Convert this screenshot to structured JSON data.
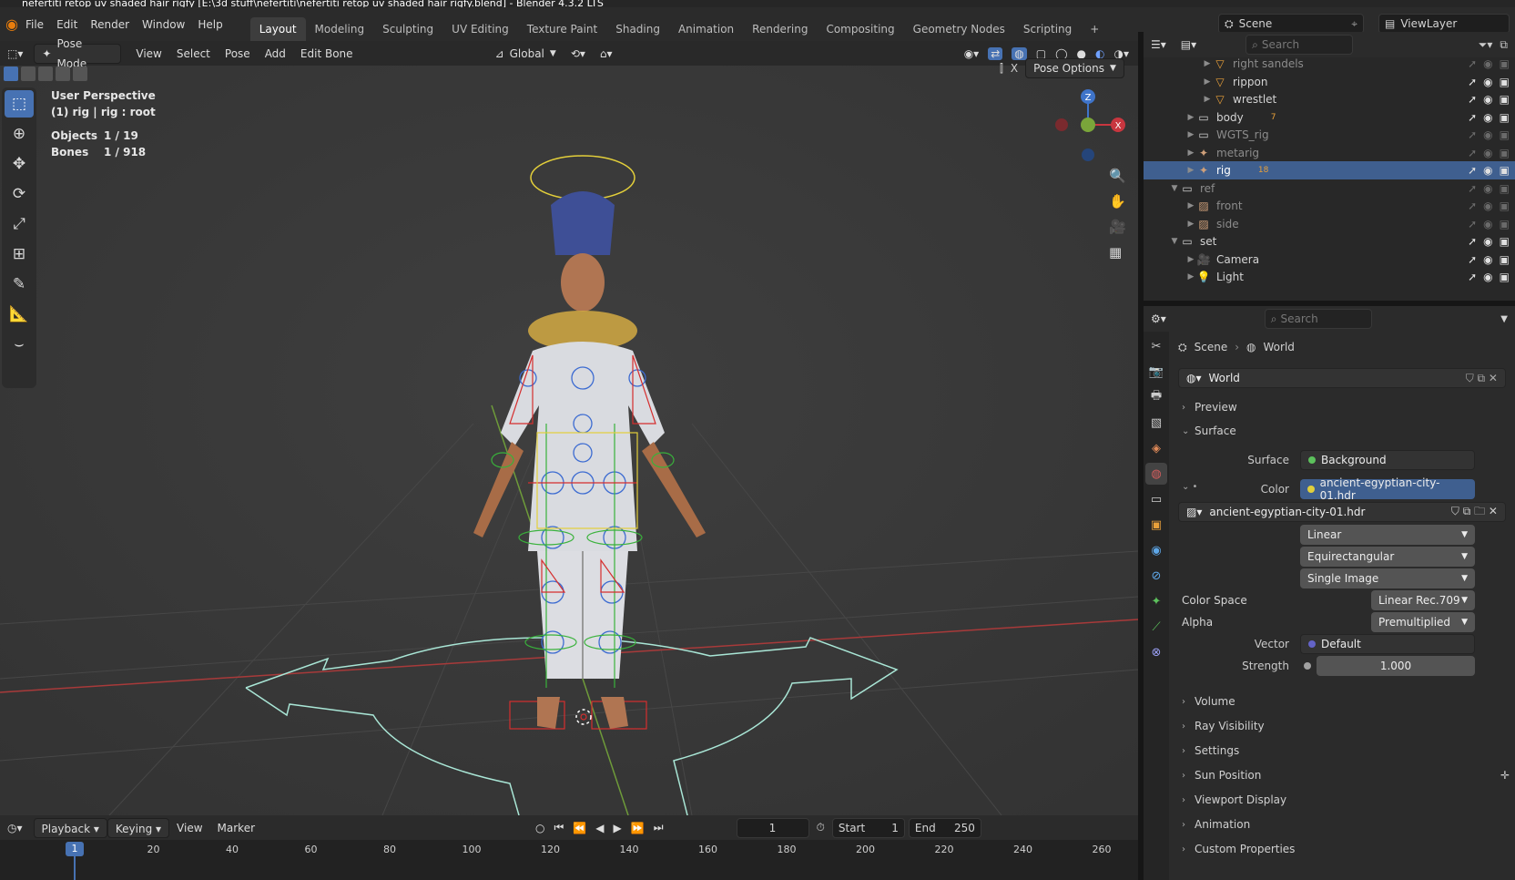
{
  "window_title": "nefertiti retop uv shaded  hair rigfy [E:\\3d stuff\\nefertiti\\nefertiti retop uv shaded  hair rigfy.blend] - Blender 4.3.2 LTS",
  "menu": [
    "File",
    "Edit",
    "Render",
    "Window",
    "Help"
  ],
  "workspaces": [
    {
      "label": "Layout",
      "active": true
    },
    {
      "label": "Modeling",
      "active": false
    },
    {
      "label": "Sculpting",
      "active": false
    },
    {
      "label": "UV Editing",
      "active": false
    },
    {
      "label": "Texture Paint",
      "active": false
    },
    {
      "label": "Shading",
      "active": false
    },
    {
      "label": "Animation",
      "active": false
    },
    {
      "label": "Rendering",
      "active": false
    },
    {
      "label": "Compositing",
      "active": false
    },
    {
      "label": "Geometry Nodes",
      "active": false
    },
    {
      "label": "Scripting",
      "active": false
    }
  ],
  "add_workspace": "+",
  "scene": {
    "name": "Scene"
  },
  "view_layer": {
    "name": "ViewLayer"
  },
  "viewport_header": {
    "mode": "Pose Mode",
    "menus": [
      "View",
      "Select",
      "Pose",
      "Add",
      "Edit Bone"
    ],
    "transform_orientation": "Global",
    "pose_options": "Pose Options",
    "x_axis_label": "X"
  },
  "overlay_info": {
    "perspective": "User Perspective",
    "context": "(1) rig | rig : root",
    "objects_label": "Objects",
    "objects_value": "1 / 19",
    "bones_label": "Bones",
    "bones_value": "1 / 918"
  },
  "gizmo": {
    "z": "Z",
    "x": "X"
  },
  "timeline": {
    "menus": [
      "Playback",
      "Keying",
      "View",
      "Marker"
    ],
    "current_frame": "1",
    "start_label": "Start",
    "start_value": "1",
    "end_label": "End",
    "end_value": "250",
    "ruler": [
      "1",
      "20",
      "40",
      "60",
      "80",
      "100",
      "120",
      "140",
      "160",
      "180",
      "200",
      "220",
      "240",
      "260"
    ]
  },
  "outliner": {
    "search_placeholder": "Search",
    "items": [
      {
        "label": "right sandels",
        "indent": 3,
        "icon": "mesh-icon",
        "sel": false,
        "dim": true
      },
      {
        "label": "rippon",
        "indent": 3,
        "icon": "mesh-icon",
        "sel": false,
        "dim": false
      },
      {
        "label": "wrestlet",
        "indent": 3,
        "icon": "mesh-icon",
        "sel": false,
        "dim": false
      },
      {
        "label": "body",
        "indent": 2,
        "icon": "collection-icon",
        "sel": false,
        "dim": false
      },
      {
        "label": "WGTS_rig",
        "indent": 2,
        "icon": "collection-icon",
        "sel": false,
        "dim": true
      },
      {
        "label": "metarig",
        "indent": 2,
        "icon": "armature-icon",
        "sel": false,
        "dim": true
      },
      {
        "label": "rig",
        "indent": 2,
        "icon": "armature-icon",
        "sel": true,
        "dim": false
      },
      {
        "label": "ref",
        "indent": 1,
        "icon": "collection-icon",
        "sel": false,
        "dim": true
      },
      {
        "label": "front",
        "indent": 2,
        "icon": "image-icon",
        "sel": false,
        "dim": true
      },
      {
        "label": "side",
        "indent": 2,
        "icon": "image-icon",
        "sel": false,
        "dim": true
      },
      {
        "label": "set",
        "indent": 1,
        "icon": "collection-icon",
        "sel": false,
        "dim": false
      },
      {
        "label": "Camera",
        "indent": 2,
        "icon": "camera-icon",
        "sel": false,
        "dim": false
      },
      {
        "label": "Light",
        "indent": 2,
        "icon": "light-icon",
        "sel": false,
        "dim": false
      }
    ],
    "body_count": "7",
    "rig_count": "18"
  },
  "properties": {
    "search_placeholder": "Search",
    "breadcrumb": [
      "Scene",
      "World"
    ],
    "world_name": "World",
    "panels_top": [
      "Preview",
      "Surface"
    ],
    "surface_label": "Surface",
    "surface_value": "Background",
    "color_label": "Color",
    "color_value": "ancient-egyptian-city-01.hdr",
    "image_name": "ancient-egyptian-city-01.hdr",
    "interpolation": "Linear",
    "projection": "Equirectangular",
    "source": "Single Image",
    "color_space_label": "Color Space",
    "color_space_value": "Linear Rec.709",
    "alpha_label": "Alpha",
    "alpha_value": "Premultiplied",
    "vector_label": "Vector",
    "vector_value": "Default",
    "strength_label": "Strength",
    "strength_value": "1.000",
    "panels_bottom": [
      "Volume",
      "Ray Visibility",
      "Settings",
      "Sun Position",
      "Viewport Display",
      "Animation",
      "Custom Properties"
    ]
  },
  "colors": {
    "accent": "#4772b3",
    "selected_row": "#3f5f8f",
    "x_axis": "#c8363f",
    "y_axis": "#7aa53a",
    "z_axis": "#3f74c9"
  }
}
